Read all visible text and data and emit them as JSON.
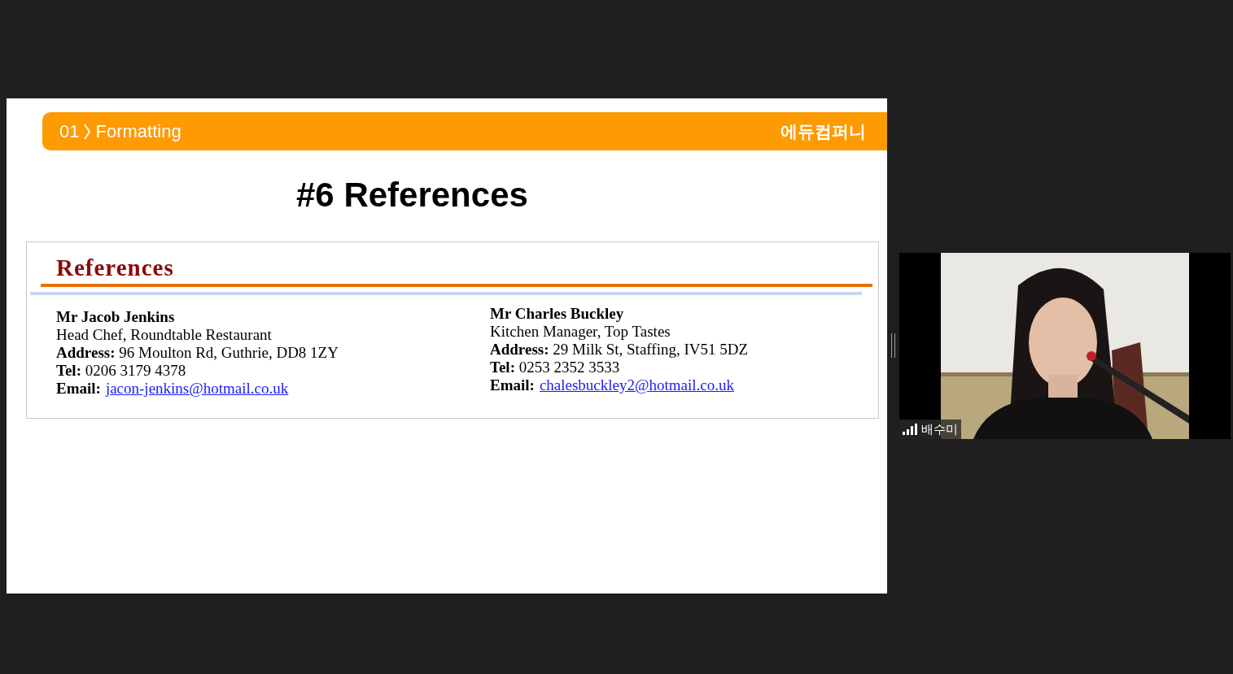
{
  "slide": {
    "section_number": "01",
    "section_title": "Formatting",
    "logo": "에듀컴퍼니",
    "title": "#6 References",
    "document": {
      "heading": "References",
      "references": [
        {
          "name": "Mr Jacob Jenkins",
          "position": "Head Chef, Roundtable Restaurant",
          "details": [
            "**Address:** 96 Moulton Rd, Guthrie, DD8 1ZY",
            "**Tel:** 0206 3179 4378"
          ],
          "email_label": "Email:",
          "email": "jacon-jenkins@hotmail.co.uk"
        },
        {
          "name": "Mr Charles Buckley",
          "position": "Kitchen Manager, Top Tastes",
          "details": [
            "**Address:** 29 Milk  St, Staffing, IV51 5DZ",
            "**Tel:** 0253 2352 3533"
          ],
          "email_label": "Email:",
          "email": "chalesbuckley2@hotmail.co.uk"
        }
      ]
    }
  },
  "video": {
    "participant_name": "배수미"
  }
}
